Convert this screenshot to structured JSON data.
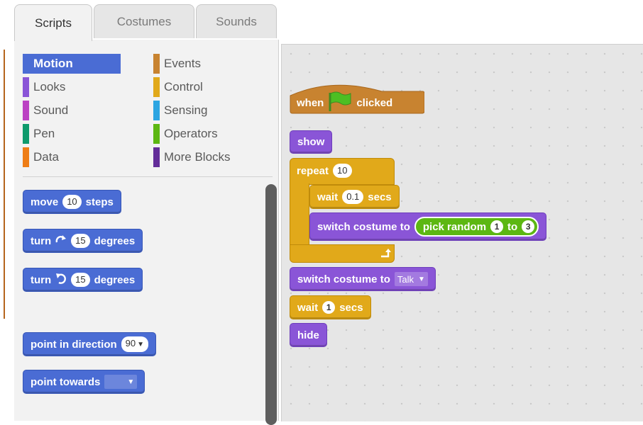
{
  "tabs": [
    {
      "label": "Scripts",
      "active": true
    },
    {
      "label": "Costumes",
      "active": false
    },
    {
      "label": "Sounds",
      "active": false
    }
  ],
  "categories": [
    {
      "label": "Motion",
      "color": "#4a6cd4",
      "selected": true
    },
    {
      "label": "Looks",
      "color": "#8a55d7",
      "selected": false
    },
    {
      "label": "Sound",
      "color": "#bb42c3",
      "selected": false
    },
    {
      "label": "Pen",
      "color": "#0e9a6c",
      "selected": false
    },
    {
      "label": "Data",
      "color": "#ee7d16",
      "selected": false
    },
    {
      "label": "Events",
      "color": "#c88330",
      "selected": false
    },
    {
      "label": "Control",
      "color": "#e1a91a",
      "selected": false
    },
    {
      "label": "Sensing",
      "color": "#2ca5e2",
      "selected": false
    },
    {
      "label": "Operators",
      "color": "#5cb712",
      "selected": false
    },
    {
      "label": "More Blocks",
      "color": "#632d99",
      "selected": false
    }
  ],
  "palette_blocks": {
    "move": {
      "word": "move",
      "value": "10",
      "suffix": "steps"
    },
    "turn_right": {
      "word": "turn",
      "icon": "rotate-clockwise-icon",
      "value": "15",
      "suffix": "degrees"
    },
    "turn_left": {
      "word": "turn",
      "icon": "rotate-counterclockwise-icon",
      "value": "15",
      "suffix": "degrees"
    },
    "point_direction": {
      "text": "point in direction",
      "value": "90"
    },
    "point_towards": {
      "text": "point towards",
      "value": ""
    }
  },
  "script": {
    "when_flag": {
      "prefix": "when",
      "icon": "green-flag-icon",
      "suffix": "clicked"
    },
    "show": {
      "text": "show"
    },
    "repeat": {
      "word": "repeat",
      "count": "10",
      "loop_icon": "loop-arrow-icon"
    },
    "wait_inner": {
      "word": "wait",
      "value": "0.1",
      "suffix": "secs"
    },
    "switch_random": {
      "text": "switch costume to",
      "op_word": "pick random",
      "from": "1",
      "to_word": "to",
      "to": "3"
    },
    "switch_talk": {
      "text": "switch costume to",
      "value": "Talk"
    },
    "wait_outer": {
      "word": "wait",
      "value": "1",
      "suffix": "secs"
    },
    "hide": {
      "text": "hide"
    }
  },
  "colors": {
    "motion": "#4a6cd4",
    "looks": "#8a55d7",
    "events": "#c88330",
    "control": "#e1a91a",
    "operators": "#5cb712"
  }
}
